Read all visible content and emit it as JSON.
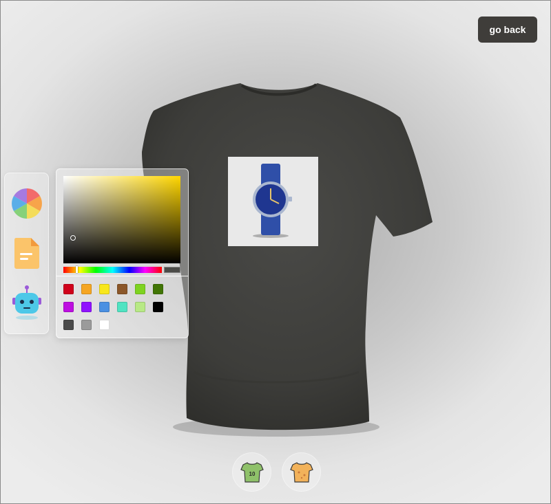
{
  "header": {
    "go_back_label": "go back"
  },
  "shirt": {
    "color": "#3f3f3c"
  },
  "decal": {
    "subject": "wristwatch-image"
  },
  "toolbar": {
    "items": [
      {
        "name": "color-picker-tool",
        "icon": "color-wheel-icon"
      },
      {
        "name": "file-picker-tool",
        "icon": "document-icon"
      },
      {
        "name": "ai-picker-tool",
        "icon": "robot-icon"
      }
    ]
  },
  "color_picker": {
    "selected_hue": "#ffd600",
    "current_color": "#4b4b48",
    "swatches": [
      "#d0021b",
      "#f5a623",
      "#f8e71c",
      "#8b572a",
      "#7ed321",
      "#417505",
      "#bd10e0",
      "#9013fe",
      "#4a90e2",
      "#50e3c2",
      "#b8e986",
      "#000000",
      "#4a4a4a",
      "#9b9b9b",
      "#ffffff"
    ]
  },
  "bottom_bar": {
    "items": [
      {
        "name": "logo-shirt-toggle",
        "icon": "logo-shirt-icon",
        "number": "10",
        "color": "#8fc16a"
      },
      {
        "name": "full-texture-toggle",
        "icon": "stylish-shirt-icon",
        "color": "#f2b25a"
      }
    ]
  }
}
